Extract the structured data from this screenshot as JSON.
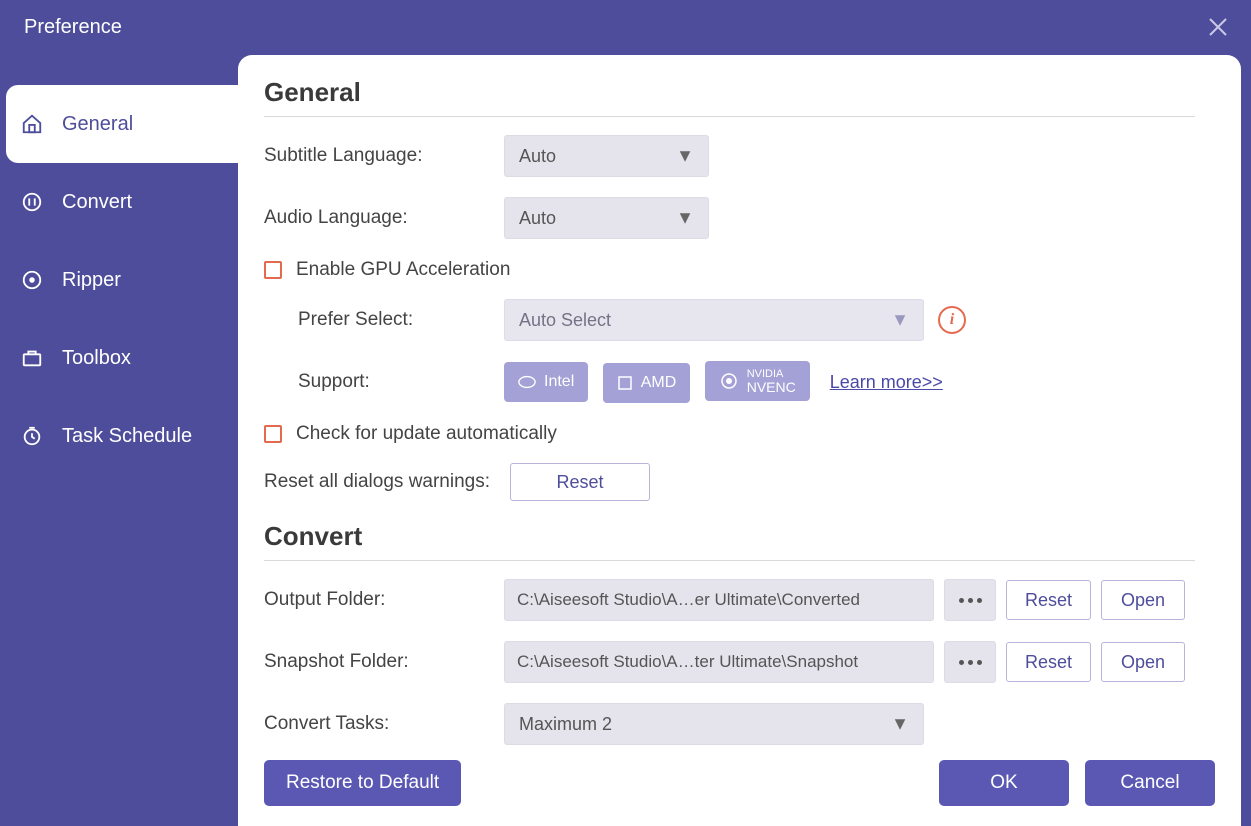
{
  "window": {
    "title": "Preference"
  },
  "sidebar": {
    "items": [
      {
        "label": "General"
      },
      {
        "label": "Convert"
      },
      {
        "label": "Ripper"
      },
      {
        "label": "Toolbox"
      },
      {
        "label": "Task Schedule"
      }
    ],
    "active_index": 0
  },
  "sections": {
    "general": {
      "heading": "General",
      "subtitle_lang_label": "Subtitle Language:",
      "subtitle_lang_value": "Auto",
      "audio_lang_label": "Audio Language:",
      "audio_lang_value": "Auto",
      "gpu_enable_label": "Enable GPU Acceleration",
      "prefer_select_label": "Prefer Select:",
      "prefer_select_value": "Auto Select",
      "support_label": "Support:",
      "gpu_badges": {
        "intel": "Intel",
        "amd": "AMD",
        "nvidia_top": "NVIDIA",
        "nvidia_bottom": "NVENC"
      },
      "learn_more": "Learn more>>",
      "check_update_label": "Check for update automatically",
      "reset_dialogs_label": "Reset all dialogs warnings:",
      "reset_button": "Reset"
    },
    "convert": {
      "heading": "Convert",
      "output_folder_label": "Output Folder:",
      "output_folder_value": "C:\\Aiseesoft Studio\\A…er Ultimate\\Converted",
      "snapshot_folder_label": "Snapshot Folder:",
      "snapshot_folder_value": "C:\\Aiseesoft Studio\\A…ter Ultimate\\Snapshot",
      "reset_button": "Reset",
      "open_button": "Open",
      "convert_tasks_label": "Convert Tasks:",
      "convert_tasks_value": "Maximum 2"
    }
  },
  "footer": {
    "restore": "Restore to Default",
    "ok": "OK",
    "cancel": "Cancel"
  }
}
